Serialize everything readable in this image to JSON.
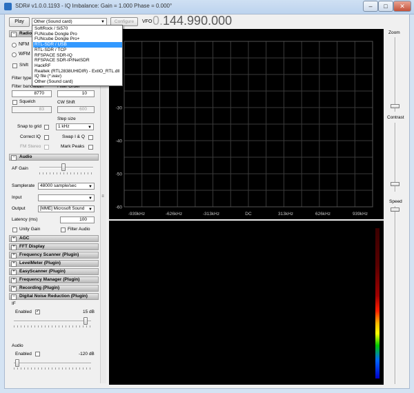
{
  "window": {
    "title": "SDR# v1.0.0.1193 - IQ Imbalance: Gain = 1.000 Phase = 0.000°"
  },
  "toolbar": {
    "play_label": "Play",
    "source_selected": "Other (Sound card)",
    "configure_label": "Configure",
    "vfo_label": "VFO",
    "vfo_prefix": "0.",
    "vfo_value": "144.990.000"
  },
  "source_options": [
    "SoftRock / Si570",
    "FUNcube Dongle Pro",
    "FUNcube Dongle Pro+",
    "RTL-SDR / USB",
    "RTL-SDR / TCP",
    "RFSPACE SDR-IQ",
    "RFSPACE SDR-IP/NetSDR",
    "HackRF",
    "Realtek (RTL2838UHIDIR) - ExtIO_RTL.dll",
    "IQ file (*.wav)",
    "Other (Sound card)"
  ],
  "source_highlighted": "RTL-SDR / USB",
  "radio": {
    "header": "Radio",
    "nfm": "NFM",
    "wfm": "WFM",
    "shift": "Shift",
    "filter_type": "Filter type",
    "filter_bandwidth": "Filter bandwidth",
    "filter_order": "Filter Order",
    "bandwidth_value": "8770",
    "order_value": "10",
    "squelch": "Squelch",
    "cw_shift": "CW Shift",
    "squelch_value": "83",
    "cw_value": "600",
    "step_size": "Step size",
    "snap_to_grid": "Snap to grid",
    "step_value": "1 kHz",
    "correct_iq": "Correct IQ",
    "swap_iq": "Swap I & Q",
    "fm_stereo": "FM Stereo",
    "mark_peaks": "Mark Peaks"
  },
  "audio": {
    "header": "Audio",
    "af_gain": "AF Gain",
    "af_gain_level": 0.45,
    "samplerate_label": "Samplerate",
    "samplerate_value": "48000 sample/sec",
    "input_label": "Input",
    "input_value": "",
    "output_label": "Output",
    "output_value": "[MME] Microsoft Sound",
    "latency_label": "Latency (ms)",
    "latency_value": "100",
    "unity_gain": "Unity Gain",
    "filter_audio": "Filter Audio"
  },
  "sections": [
    "AGC",
    "FFT Display",
    "Frequency Scanner (Plugin)",
    "LevelMeter (Plugin)",
    "EasyScanner (Plugin)",
    "Frequency Manager (Plugin)",
    "Recording (Plugin)"
  ],
  "dnr": {
    "header": "Digital Noise Reduction (Plugin)",
    "if_label": "IF",
    "if_enabled": "Enabled",
    "if_db": "15 dB",
    "if_level": 0.95,
    "audio_label": "Audio",
    "audio_enabled": "Enabled",
    "audio_db": "-120 dB",
    "audio_level": 0.02
  },
  "right_panel": {
    "zoom": "Zoom",
    "contrast": "Contrast",
    "speed": "Speed"
  },
  "colors": {
    "selection": "#3399ff",
    "panel_bg": "#f0f0f0",
    "spectrum_bg": "#000000"
  },
  "chart_data": {
    "type": "line",
    "y_ticks": [
      "-20",
      "-30",
      "-40",
      "-50",
      "-60"
    ],
    "x_ticks": [
      "-939kHz",
      "-626kHz",
      "-313kHz",
      "DC",
      "313kHz",
      "626kHz",
      "939kHz"
    ],
    "ylim": [
      -60,
      -10
    ],
    "grid": true
  }
}
